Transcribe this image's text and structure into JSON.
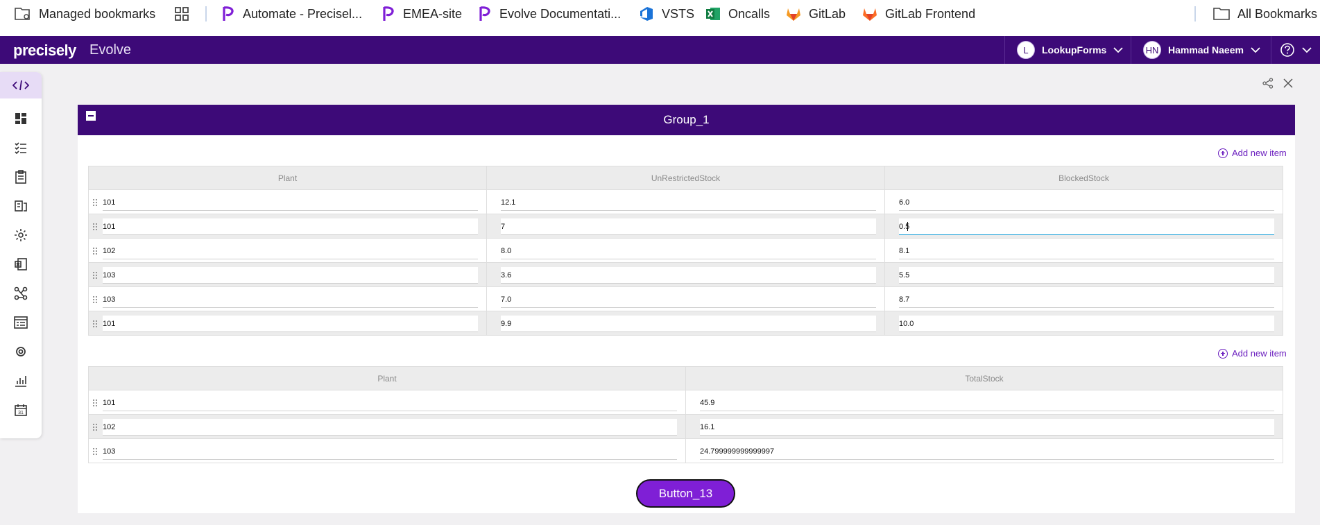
{
  "bookmarks": {
    "managed": "Managed bookmarks",
    "items": [
      {
        "label": "Automate - Precisel..."
      },
      {
        "label": "EMEA-site"
      },
      {
        "label": "Evolve Documentati..."
      },
      {
        "label": "VSTS"
      },
      {
        "label": "Oncalls"
      },
      {
        "label": "GitLab"
      },
      {
        "label": "GitLab Frontend"
      }
    ],
    "all": "All Bookmarks"
  },
  "header": {
    "logo": "precisely",
    "app": "Evolve",
    "workspace_initial": "L",
    "workspace": "LookupForms",
    "user_initials": "HN",
    "user": "Hammad Naeem"
  },
  "group": {
    "title": "Group_1",
    "add_new_label": "Add new item"
  },
  "table1": {
    "columns": [
      "Plant",
      "UnRestrictedStock",
      "BlockedStock"
    ],
    "rows": [
      [
        "101",
        "12.1",
        "6.0"
      ],
      [
        "101",
        "7",
        "0.5"
      ],
      [
        "102",
        "8.0",
        "8.1"
      ],
      [
        "103",
        "3.6",
        "5.5"
      ],
      [
        "103",
        "7.0",
        "8.7"
      ],
      [
        "101",
        "9.9",
        "10.0"
      ]
    ]
  },
  "table2": {
    "columns": [
      "Plant",
      "TotalStock"
    ],
    "rows": [
      [
        "101",
        "45.9"
      ],
      [
        "102",
        "16.1"
      ],
      [
        "103",
        "24.799999999999997"
      ]
    ]
  },
  "button": {
    "label": "Button_13"
  },
  "colors": {
    "brand": "#3d0a78",
    "accent": "#7f1fd6",
    "link": "#6b1fbf"
  }
}
